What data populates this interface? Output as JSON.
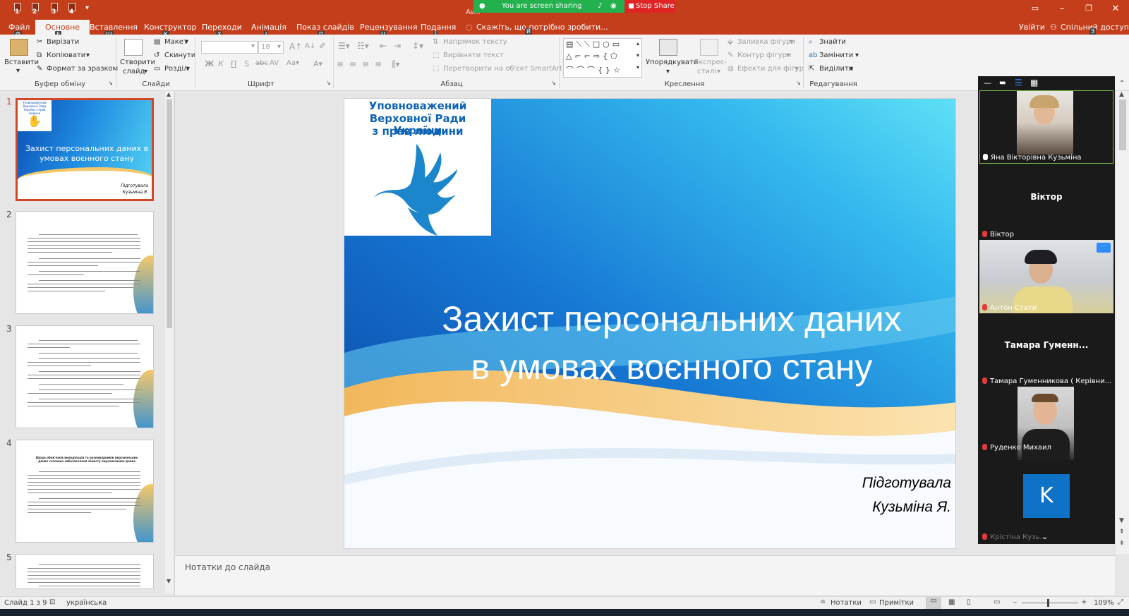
{
  "titlebar": {
    "doc_title": "Av...",
    "qat_badges": [
      "1",
      "2",
      "3",
      "4"
    ],
    "share_banner": "You are screen sharing",
    "stop_share": "Stop Share",
    "win_controls": [
      "restore-ribbon-icon",
      "minimize-icon",
      "maximize-icon",
      "close-icon"
    ]
  },
  "tabs": [
    {
      "label": "Файл",
      "key": "Ф"
    },
    {
      "label": "Основне",
      "key": "Е",
      "active": true
    },
    {
      "label": "Вставлення",
      "key": "Щ"
    },
    {
      "label": "Конструктор",
      "key": "К"
    },
    {
      "label": "Переходи",
      "key": "Х"
    },
    {
      "label": "Анімація",
      "key": "І"
    },
    {
      "label": "Показ слайдів",
      "key": "П"
    },
    {
      "label": "Рецензування",
      "key": "Ц"
    },
    {
      "label": "Подання",
      "key": "Ї"
    }
  ],
  "tellme": "Скажіть, що потрібно зробити...",
  "tellme_key": "Й",
  "signin": "Увійти",
  "share": "Спільний доступ",
  "share_key": "З",
  "ribbon": {
    "clipboard": {
      "paste": "Вставити",
      "cut": "Вирізати",
      "copy": "Копіювати",
      "format_painter": "Формат за зразком",
      "label": "Буфер обміну"
    },
    "slides": {
      "new_slide_1": "Створити",
      "new_slide_2": "слайд",
      "layout": "Макет",
      "reset": "Скинути",
      "section": "Розділ",
      "label": "Слайди"
    },
    "font": {
      "size": "18",
      "label": "Шрифт"
    },
    "paragraph": {
      "text_direction": "Напрямок тексту",
      "align_text": "Вирівняти текст",
      "smartart": "Перетворити на об'єкт SmartArt",
      "label": "Абзац"
    },
    "drawing": {
      "arrange": "Упорядкувати",
      "quick_styles_1": "Експрес-",
      "quick_styles_2": "стилі",
      "shape_fill": "Заливка фігури",
      "shape_outline": "Контур фігури",
      "shape_effects": "Ефекти для фігур",
      "label": "Креслення"
    },
    "editing": {
      "find": "Знайти",
      "replace": "Замінити",
      "select": "Виділити",
      "label": "Редагування"
    }
  },
  "thumbnails": [
    "1",
    "2",
    "3",
    "4",
    "5"
  ],
  "slide": {
    "org_line1": "Уповноважений",
    "org_line2": "Верховної Ради України",
    "org_line3": "з прав людини",
    "title_line1": "Захист персональних даних",
    "title_line2": "в умовах воєнного стану",
    "author_line1": "Підготувала",
    "author_line2": "Кузьміна Я."
  },
  "thumb1": {
    "org": "Уповноважений Верховної Ради України з прав людини",
    "title": "Захист персональних даних в умовах воєнного стану",
    "author_line1": "Підготувала",
    "author_line2": "Кузьміна Я."
  },
  "thumb4_heading": "Щодо обов'язків володільців та розпорядників персональних даних стосовно забезпечення захисту персональних даних",
  "notes_placeholder": "Нотатки до слайда",
  "status": {
    "slide_counter": "Слайд 1 з 9",
    "language": "українська",
    "notes": "Нотатки",
    "comments": "Примітки",
    "zoom": "109%"
  },
  "zoom_participants": [
    {
      "name": "Яна Вікторівна Кузьміна",
      "type": "video",
      "muted": false
    },
    {
      "name": "Віктор",
      "display": "Віктор",
      "type": "name",
      "muted": true
    },
    {
      "name": "Антон Стати",
      "type": "video",
      "muted": true
    },
    {
      "name": "Тамара Гуменникова ( Керівни...",
      "display": "Тамара  Гуменн...",
      "type": "name",
      "muted": true
    },
    {
      "name": "Руденко Михаил",
      "type": "video",
      "muted": true
    },
    {
      "name": "Крістіна Кузь...",
      "initial": "K",
      "type": "avatar",
      "muted": true
    }
  ],
  "colors": {
    "accent": "#c43e1c",
    "selected_thumb": "#d24726",
    "zoom_bg": "#1a1a1a",
    "share_green": "#22b14c",
    "stop_red": "#e02424",
    "avatar_blue": "#0e72c6"
  }
}
